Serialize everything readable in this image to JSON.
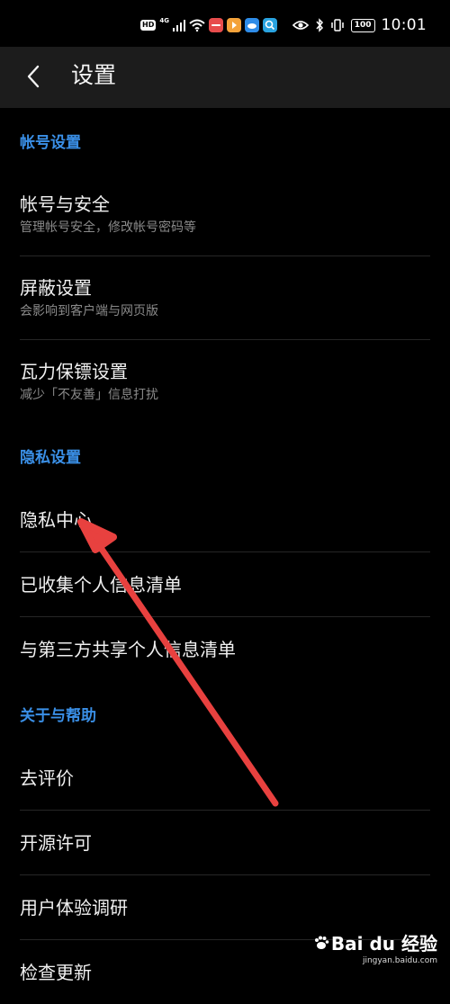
{
  "status_bar": {
    "hd": "HD",
    "net": "4G",
    "battery": "100",
    "time": "10:01",
    "icons": [
      "signal-icon",
      "wifi-icon",
      "app-icon-red",
      "app-icon-orange",
      "app-icon-blue",
      "app-icon-search",
      "eye-icon",
      "bluetooth-icon",
      "vibrate-icon",
      "battery-icon"
    ],
    "colors": {
      "app_red": "#e74c4c",
      "app_orange": "#f4a23a",
      "app_blue": "#2e8ce8",
      "app_search": "#29a3e0"
    }
  },
  "header": {
    "title": "设置",
    "back_icon": "chevron-left-icon"
  },
  "sections": [
    {
      "title": "帐号设置",
      "items": [
        {
          "title": "帐号与安全",
          "subtitle": "管理帐号安全，修改帐号密码等"
        },
        {
          "title": "屏蔽设置",
          "subtitle": "会影响到客户端与网页版"
        },
        {
          "title": "瓦力保镖设置",
          "subtitle": "减少「不友善」信息打扰"
        }
      ]
    },
    {
      "title": "隐私设置",
      "items": [
        {
          "title": "隐私中心"
        },
        {
          "title": "已收集个人信息清单"
        },
        {
          "title": "与第三方共享个人信息清单"
        }
      ]
    },
    {
      "title": "关于与帮助",
      "items": [
        {
          "title": "去评价"
        },
        {
          "title": "开源许可"
        },
        {
          "title": "用户体验调研"
        },
        {
          "title": "检查更新"
        }
      ]
    }
  ],
  "theme": {
    "accent": "#3a8fe6",
    "background": "#000000",
    "header_bg": "#1c1c1c",
    "arrow": "#e8413f"
  },
  "watermark": {
    "logo": "Bai du 经验",
    "url": "jingyan.baidu.com"
  }
}
